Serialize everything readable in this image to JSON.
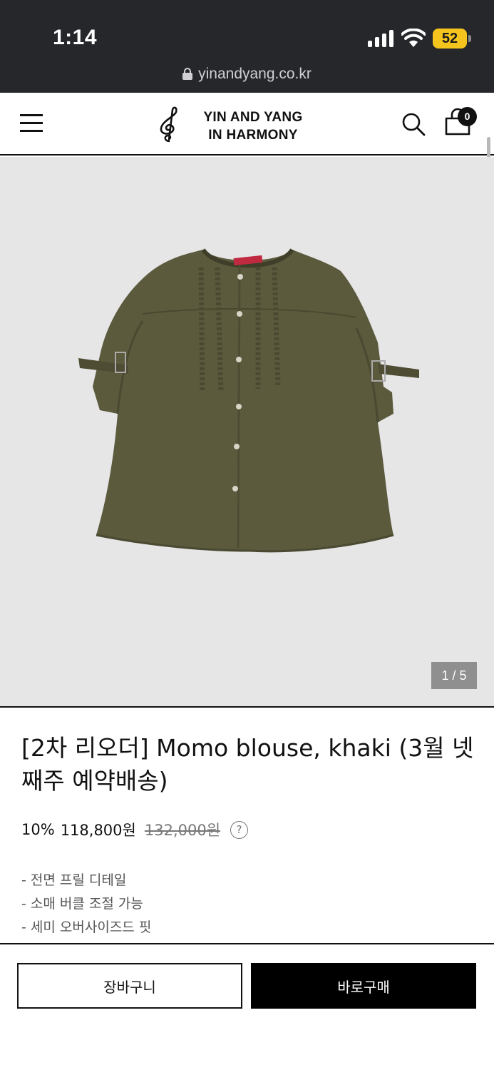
{
  "status_bar": {
    "time": "1:14",
    "battery": "52",
    "url": "yinandyang.co.kr"
  },
  "header": {
    "brand_line1": "YIN AND YANG",
    "brand_line2": "IN HARMONY",
    "cart_count": "0"
  },
  "gallery": {
    "counter": "1 / 5",
    "image_icon": "khaki-blouse-photo",
    "background": "#e7e6e7"
  },
  "product": {
    "title": "[2차 리오더] Momo blouse, khaki (3월 넷째주 예약배송)",
    "discount": "10%",
    "sale_price": "118,800원",
    "original_price": "132,000원",
    "help_symbol": "?",
    "description": [
      "- 전면 프릴 디테일",
      "- 소매 버클 조절 가능",
      "- 세미 오버사이즈드 핏"
    ]
  },
  "actions": {
    "cart_label": "장바구니",
    "buy_label": "바로구매"
  },
  "colors": {
    "status_bg": "#26272b",
    "battery": "#f5c51e",
    "buy_button": "#000000",
    "blouse": "#5b5a3d"
  }
}
